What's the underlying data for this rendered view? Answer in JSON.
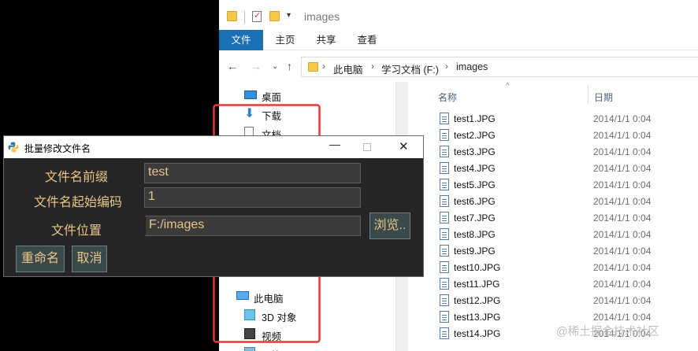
{
  "explorer": {
    "window_title": "images",
    "quick_access": {
      "dropdown_glyph": "▾"
    },
    "ribbon_tabs": [
      "文件",
      "主页",
      "共享",
      "查看"
    ],
    "nav": {
      "back": "←",
      "forward": "→",
      "recent": "⌄",
      "up": "↑",
      "sep": "›"
    },
    "breadcrumb": [
      "此电脑",
      "学习文档 (F:)",
      "images"
    ],
    "nav_pane": {
      "pin_glyph": "📌",
      "pinned": [
        {
          "label": "桌面",
          "icon": "desktop-icon"
        },
        {
          "label": "下载",
          "icon": "download-icon"
        },
        {
          "label": "文档",
          "icon": "document-icon"
        }
      ],
      "tree": [
        {
          "label": "此电脑",
          "icon": "computer-icon"
        },
        {
          "label": "3D 对象",
          "icon": "3d-objects-icon"
        },
        {
          "label": "视频",
          "icon": "video-icon"
        },
        {
          "label": "图片",
          "icon": "pictures-icon"
        }
      ]
    },
    "columns": {
      "name": "名称",
      "date": "日期",
      "sort_glyph": "^"
    },
    "files": [
      {
        "name": "test1.JPG",
        "date": "2014/1/1 0:04"
      },
      {
        "name": "test2.JPG",
        "date": "2014/1/1 0:04"
      },
      {
        "name": "test3.JPG",
        "date": "2014/1/1 0:04"
      },
      {
        "name": "test4.JPG",
        "date": "2014/1/1 0:04"
      },
      {
        "name": "test5.JPG",
        "date": "2014/1/1 0:04"
      },
      {
        "name": "test6.JPG",
        "date": "2014/1/1 0:04"
      },
      {
        "name": "test7.JPG",
        "date": "2014/1/1 0:04"
      },
      {
        "name": "test8.JPG",
        "date": "2014/1/1 0:04"
      },
      {
        "name": "test9.JPG",
        "date": "2014/1/1 0:04"
      },
      {
        "name": "test10.JPG",
        "date": "2014/1/1 0:04"
      },
      {
        "name": "test11.JPG",
        "date": "2014/1/1 0:04"
      },
      {
        "name": "test12.JPG",
        "date": "2014/1/1 0:04"
      },
      {
        "name": "test13.JPG",
        "date": "2014/1/1 0:04"
      },
      {
        "name": "test14.JPG",
        "date": "2014/1/1 0:04"
      }
    ],
    "highlight_color": "#e53935"
  },
  "dialog": {
    "title": "批量修改文件名",
    "controls": {
      "minimize": "—",
      "close": "✕"
    },
    "fields": [
      {
        "label": "文件名前缀",
        "value": "test"
      },
      {
        "label": "文件名起始编码",
        "value": "1"
      },
      {
        "label": "文件位置",
        "value": "F:/images"
      }
    ],
    "browse_label": "浏览..",
    "rename_label": "重命名",
    "cancel_label": "取消",
    "colors": {
      "background": "#262626",
      "text": "#e8c58a",
      "button": "#3a4a4a"
    }
  },
  "watermark": "@稀土掘金技术社区"
}
